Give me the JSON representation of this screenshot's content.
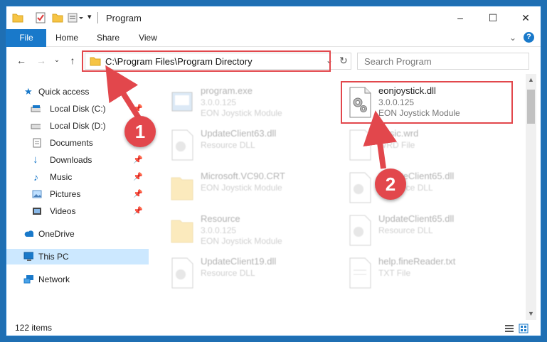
{
  "window": {
    "title": "Program",
    "controls": {
      "minimize": "–",
      "maximize": "☐",
      "close": "✕"
    }
  },
  "ribbon": {
    "tabs": [
      "File",
      "Home",
      "Share",
      "View"
    ],
    "expand": "⌄",
    "help": "?"
  },
  "navigation": {
    "back": "←",
    "forward": "→",
    "recent": "⌄",
    "up": "↑",
    "address": "C:\\Program Files\\Program Directory",
    "address_dropdown": "⌄",
    "refresh": "↻",
    "search_placeholder": "Search Program"
  },
  "sidebar": {
    "items": [
      {
        "label": "Quick access",
        "icon": "star-icon",
        "pinned": false
      },
      {
        "label": "Local Disk (C:)",
        "icon": "drive-icon",
        "pinned": true
      },
      {
        "label": "Local Disk (D:)",
        "icon": "drive-icon",
        "pinned": false
      },
      {
        "label": "Documents",
        "icon": "documents-icon",
        "pinned": true
      },
      {
        "label": "Downloads",
        "icon": "download-icon",
        "pinned": true
      },
      {
        "label": "Music",
        "icon": "music-icon",
        "pinned": true
      },
      {
        "label": "Pictures",
        "icon": "pictures-icon",
        "pinned": true
      },
      {
        "label": "Videos",
        "icon": "videos-icon",
        "pinned": true
      },
      {
        "label": "OneDrive",
        "icon": "cloud-icon",
        "pinned": false
      },
      {
        "label": "This PC",
        "icon": "computer-icon",
        "pinned": false,
        "selected": true
      },
      {
        "label": "Network",
        "icon": "network-icon",
        "pinned": false
      }
    ],
    "pin_glyph": "📌"
  },
  "files": [
    {
      "name": "program.exe",
      "line1": "3.0.0.125",
      "line2": "EON Joystick Module",
      "faded": true,
      "icon": "application-icon"
    },
    {
      "name": "eonjoystick.dll",
      "line1": "3.0.0.125",
      "line2": "EON Joystick Module",
      "faded": false,
      "icon": "dll-gear-icon",
      "highlighted": true
    },
    {
      "name": "UpdateClient63.dll",
      "line1": "Resource DLL",
      "line2": "",
      "faded": true,
      "icon": "dll-gear-icon"
    },
    {
      "name": "Basic.wrd",
      "line1": "WRD File",
      "line2": "",
      "faded": true,
      "icon": "blank-file-icon"
    },
    {
      "name": "Microsoft.VC90.CRT",
      "line1": "EON Joystick Module",
      "line2": "",
      "faded": true,
      "icon": "folder-icon"
    },
    {
      "name": "UpdateClient65.dll",
      "line1": "Resource DLL",
      "line2": "",
      "faded": true,
      "icon": "dll-gear-icon"
    },
    {
      "name": "Resource",
      "line1": "3.0.0.125",
      "line2": "EON Joystick Module",
      "faded": true,
      "icon": "folder-icon"
    },
    {
      "name": "UpdateClient65.dll",
      "line1": "Resource DLL",
      "line2": "",
      "faded": true,
      "icon": "dll-gear-icon"
    },
    {
      "name": "UpdateClient19.dll",
      "line1": "Resource DLL",
      "line2": "",
      "faded": true,
      "icon": "dll-gear-icon"
    },
    {
      "name": "help.fineReader.txt",
      "line1": "TXT File",
      "line2": "",
      "faded": true,
      "icon": "text-file-icon"
    }
  ],
  "status": {
    "item_count": "122 items"
  },
  "callouts": [
    "1",
    "2"
  ],
  "colors": {
    "accent": "#1979ca",
    "highlight": "#e2474c",
    "selection": "#cce8ff"
  }
}
